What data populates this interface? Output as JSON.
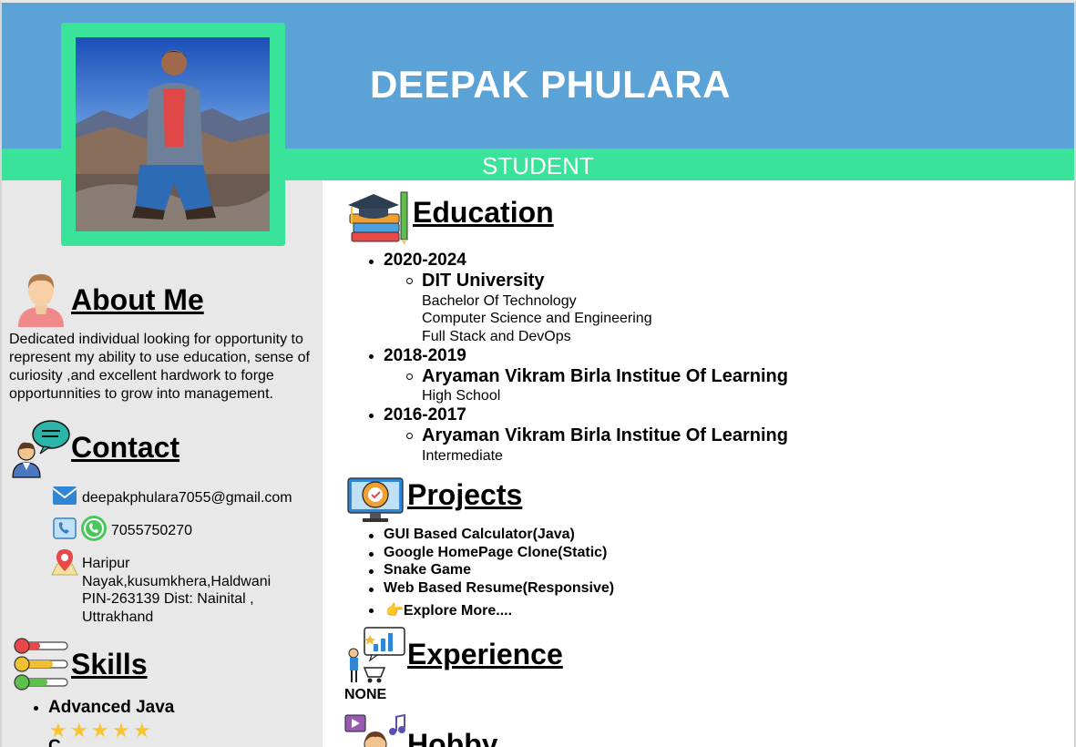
{
  "header": {
    "name": "DEEPAK PHULARA",
    "role": "STUDENT"
  },
  "colors": {
    "header_bg": "#5ba3d6",
    "accent_green": "#39e49a",
    "sidebar_bg": "#e8e8e8"
  },
  "about": {
    "title": "About Me",
    "text": "Dedicated individual looking for opportunity to represent my ability to use education, sense of curiosity ,and excellent hardwork to forge opportunnities to grow into management."
  },
  "contact": {
    "title": "Contact",
    "email": "deepakphulara7055@gmail.com",
    "phone": "7055750270",
    "address": [
      "Haripur",
      "Nayak,kusumkhera,Haldwani",
      "PIN-263139 Dist: Nainital ,",
      "Uttrakhand"
    ]
  },
  "skills": {
    "title": "Skills",
    "items": [
      {
        "name": "Advanced Java",
        "stars": 5
      },
      {
        "name": "C",
        "stars": 0
      }
    ]
  },
  "education": {
    "title": "Education",
    "entries": [
      {
        "years": "2020-2024",
        "school": "DIT University",
        "details": [
          "Bachelor Of Technology",
          "Computer Science and Engineering",
          "Full Stack and DevOps"
        ]
      },
      {
        "years": "2018-2019",
        "school": "Aryaman Vikram Birla Institue Of Learning",
        "details": [
          "High School"
        ]
      },
      {
        "years": "2016-2017",
        "school": "Aryaman Vikram Birla Institue Of Learning",
        "details": [
          "Intermediate"
        ]
      }
    ]
  },
  "projects": {
    "title": "Projects",
    "items": [
      "GUI Based Calculator(Java)",
      "Google HomePage Clone(Static)",
      "Snake Game",
      "Web Based Resume(Responsive)"
    ],
    "explore_emoji": "👉",
    "explore_label": "Explore More...."
  },
  "experience": {
    "title": "Experience",
    "value": "NONE"
  },
  "hobby": {
    "title": "Hobby"
  },
  "icons": [
    "avatar-photo",
    "person-icon",
    "contact-chat-icon",
    "email-icon",
    "phone-icon",
    "whatsapp-icon",
    "location-pin-icon",
    "skills-sliders-icon",
    "education-books-icon",
    "projects-monitor-icon",
    "experience-chart-icon",
    "hobby-music-icon",
    "star-icon"
  ]
}
